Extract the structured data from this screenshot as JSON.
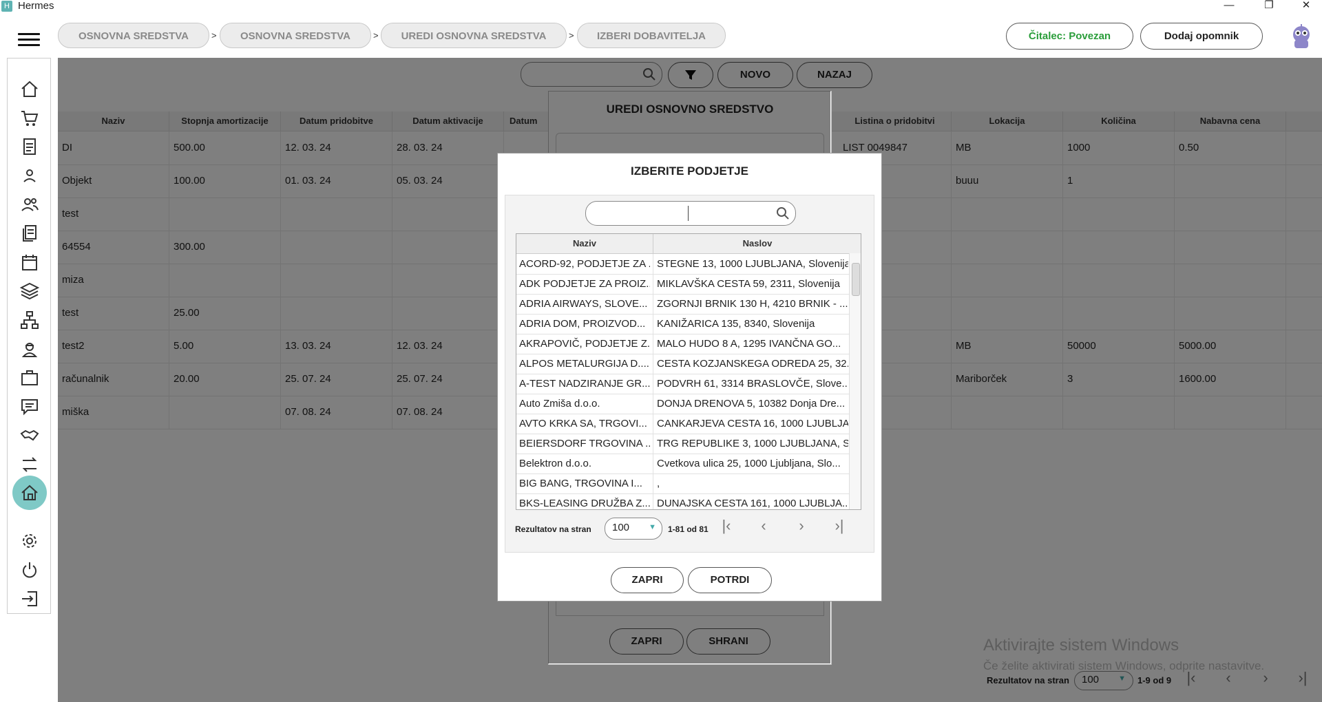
{
  "window": {
    "title": "Hermes",
    "minimize": "—",
    "restore": "❐",
    "close": "✕"
  },
  "breadcrumbs": [
    "OSNOVNA SREDSTVA",
    "OSNOVNA SREDSTVA",
    "UREDI OSNOVNA SREDSTVA",
    "IZBERI DOBAVITELJA"
  ],
  "breadcrumb_sep": ">",
  "header": {
    "reader_status": "Čitalec: Povezan",
    "reminder_button": "Dodaj opomnik"
  },
  "colors": {
    "accent": "#7fc9c6",
    "reader_green": "#2a9d3a",
    "edit_button": "#e07a6a"
  },
  "sidebar_icons": [
    "home-icon",
    "cart-icon",
    "document-icon",
    "user-icon",
    "users-icon",
    "documents-icon",
    "calendar-icon",
    "layers-icon",
    "hierarchy-icon",
    "worker-icon",
    "briefcase-icon",
    "chat-icon",
    "handshake-icon",
    "transfer-icon",
    "house-active-icon",
    "gear-icon",
    "power-icon",
    "logout-icon"
  ],
  "toolbar": {
    "new": "NOVO",
    "back": "NAZAJ"
  },
  "grid": {
    "columns": [
      "Naziv",
      "Stopnja amortizacije",
      "Datum pridobitve",
      "Datum aktivacije",
      "Datum",
      "Listina o pridobitvi",
      "Lokacija",
      "Količina",
      "Nabavna cena"
    ],
    "rows": [
      [
        "DI",
        "500.00",
        "12. 03. 24",
        "28. 03. 24",
        "LIST 0049847",
        "MB",
        "1000",
        "0.50"
      ],
      [
        "Objekt",
        "100.00",
        "01. 03. 24",
        "05. 03. 24",
        "",
        "buuu",
        "1",
        ""
      ],
      [
        "test",
        "",
        "",
        "",
        "",
        "",
        "",
        ""
      ],
      [
        "64554",
        "300.00",
        "",
        "",
        "",
        "",
        "",
        ""
      ],
      [
        "miza",
        "",
        "",
        "",
        "",
        "",
        "",
        ""
      ],
      [
        "test",
        "25.00",
        "",
        "",
        "",
        "",
        "",
        ""
      ],
      [
        "test2",
        "5.00",
        "13. 03. 24",
        "12. 03. 24",
        "",
        "MB",
        "50000",
        "5000.00"
      ],
      [
        "računalnik",
        "20.00",
        "25. 07. 24",
        "25. 07. 24",
        "",
        "Mariborček",
        "3",
        "1600.00"
      ],
      [
        "miška",
        "",
        "07. 08. 24",
        "07. 08. 24",
        "",
        "",
        "",
        ""
      ]
    ],
    "pager": {
      "label": "Rezultatov na stran",
      "per_page": "100",
      "range": "1-9 od 9"
    }
  },
  "edit_dialog": {
    "title": "UREDI OSNOVNO SREDSTVO",
    "close": "ZAPRI",
    "save": "SHRANI"
  },
  "select_dialog": {
    "title": "IZBERITE PODJETJE",
    "search_value": "",
    "columns": [
      "Naziv",
      "Naslov"
    ],
    "rows": [
      [
        "ACORD-92, PODJETJE ZA ...",
        "STEGNE 13, 1000 LJUBLJANA, Slovenija"
      ],
      [
        "ADK PODJETJE ZA PROIZ...",
        "MIKLAVŠKA CESTA 59, 2311, Slovenija"
      ],
      [
        "ADRIA AIRWAYS, SLOVE...",
        "ZGORNJI BRNIK 130 H, 4210 BRNIK - ..."
      ],
      [
        "ADRIA DOM, PROIZVOD...",
        "KANIŽARICA 135, 8340, Slovenija"
      ],
      [
        "AKRAPOVIČ, PODJETJE Z...",
        "MALO HUDO 8 A, 1295 IVANČNA GO..."
      ],
      [
        "ALPOS METALURGIJA D....",
        "CESTA KOZJANSKEGA ODREDA 25, 32..."
      ],
      [
        "A-TEST NADZIRANJE GR...",
        "PODVRH 61, 3314 BRASLOVČE, Slove..."
      ],
      [
        "Auto Zmiša d.o.o.",
        "DONJA DRENOVA 5, 10382 Donja Dre..."
      ],
      [
        "AVTO KRKA SA, TRGOVI...",
        "CANKARJEVA CESTA 16, 1000 LJUBLJA..."
      ],
      [
        "BEIERSDORF TRGOVINA ...",
        "TRG REPUBLIKE 3, 1000 LJUBLJANA, S..."
      ],
      [
        "Belektron d.o.o.",
        "Cvetkova ulica 25, 1000 Ljubljana, Slo..."
      ],
      [
        "BIG BANG, TRGOVINA I...",
        ","
      ],
      [
        "BKS-LEASING DRUŽBA Z...",
        "DUNAJSKA CESTA 161, 1000 LJUBLJA..."
      ]
    ],
    "pager": {
      "label": "Rezultatov na stran",
      "per_page": "100",
      "range": "1-81 od 81"
    },
    "close": "ZAPRI",
    "confirm": "POTRDI"
  },
  "windows_watermark": {
    "line1": "Aktivirajte sistem Windows",
    "line2": "Če želite aktivirati sistem Windows, odprite nastavitve."
  }
}
